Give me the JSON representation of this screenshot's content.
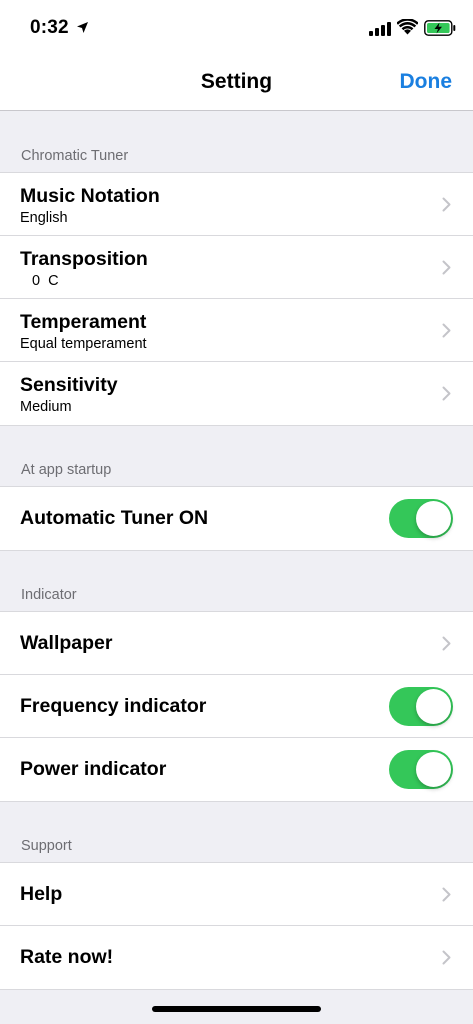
{
  "status_bar": {
    "time": "0:32"
  },
  "nav": {
    "title": "Setting",
    "done_label": "Done"
  },
  "sections": [
    {
      "header": "Chromatic Tuner",
      "rows": [
        {
          "title": "Music Notation",
          "subtitle": "English"
        },
        {
          "title": "Transposition",
          "subtitle": "0  C"
        },
        {
          "title": "Temperament",
          "subtitle": "Equal temperament"
        },
        {
          "title": "Sensitivity",
          "subtitle": "Medium"
        }
      ]
    },
    {
      "header": "At app startup",
      "rows": [
        {
          "title": "Automatic Tuner ON",
          "toggle": true
        }
      ]
    },
    {
      "header": "Indicator",
      "rows": [
        {
          "title": "Wallpaper"
        },
        {
          "title": "Frequency indicator",
          "toggle": true
        },
        {
          "title": "Power indicator",
          "toggle": true
        }
      ]
    },
    {
      "header": "Support",
      "rows": [
        {
          "title": "Help"
        },
        {
          "title": "Rate now!"
        }
      ]
    }
  ],
  "colors": {
    "accent": "#1a7fe0",
    "toggle_on": "#34c759",
    "background": "#efeff4"
  }
}
